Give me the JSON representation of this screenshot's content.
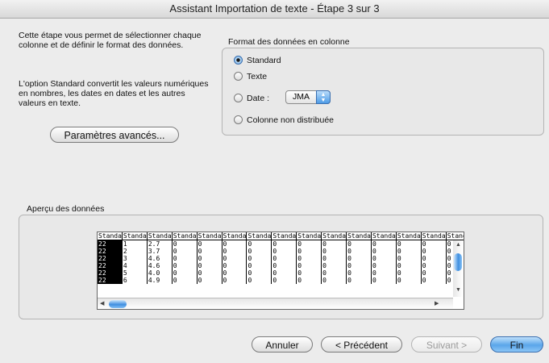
{
  "window": {
    "title": "Assistant Importation de texte - Étape 3 sur 3"
  },
  "description": {
    "para1": "Cette étape vous permet de sélectionner chaque colonne et de définir le format des données.",
    "para2": "L'option Standard convertit les valeurs numériques en nombres, les dates en dates et les autres valeurs en texte."
  },
  "buttons": {
    "advanced": "Paramètres avancés...",
    "cancel": "Annuler",
    "previous": "< Précédent",
    "next": "Suivant >",
    "finish": "Fin"
  },
  "column_format": {
    "label": "Format des données en colonne",
    "options": {
      "standard": "Standard",
      "text": "Texte",
      "date": "Date :",
      "skip": "Colonne non distribuée"
    },
    "selected": "standard",
    "date_format": "JMA"
  },
  "preview": {
    "label": "Aperçu des données",
    "headers": [
      "Standa",
      "Standa",
      "Standa",
      "Standa",
      "Standa",
      "Standa",
      "Standa",
      "Standa",
      "Standa",
      "Standa",
      "Standa",
      "Standa",
      "Standa",
      "Standa",
      "Standa"
    ],
    "rows": [
      [
        "22",
        "1",
        "2.7",
        "0",
        "0",
        "0",
        "0",
        "0",
        "0",
        "0",
        "0",
        "0",
        "0",
        "0",
        "0"
      ],
      [
        "22",
        "2",
        "3.7",
        "0",
        "0",
        "0",
        "0",
        "0",
        "0",
        "0",
        "0",
        "0",
        "0",
        "0",
        "0"
      ],
      [
        "22",
        "3",
        "4.6",
        "0",
        "0",
        "0",
        "0",
        "0",
        "0",
        "0",
        "0",
        "0",
        "0",
        "0",
        "0"
      ],
      [
        "22",
        "4",
        "4.6",
        "0",
        "0",
        "0",
        "0",
        "0",
        "0",
        "0",
        "0",
        "0",
        "0",
        "0",
        "0"
      ],
      [
        "22",
        "5",
        "4.0",
        "0",
        "0",
        "0",
        "0",
        "0",
        "0",
        "0",
        "0",
        "0",
        "0",
        "0",
        "0"
      ],
      [
        "22",
        "6",
        "4.9",
        "0",
        "0",
        "0",
        "0",
        "0",
        "0",
        "0",
        "0",
        "0",
        "0",
        "0",
        "0"
      ]
    ]
  },
  "colors": {
    "accent": "#4d9be6",
    "selected_column": "#000000"
  }
}
